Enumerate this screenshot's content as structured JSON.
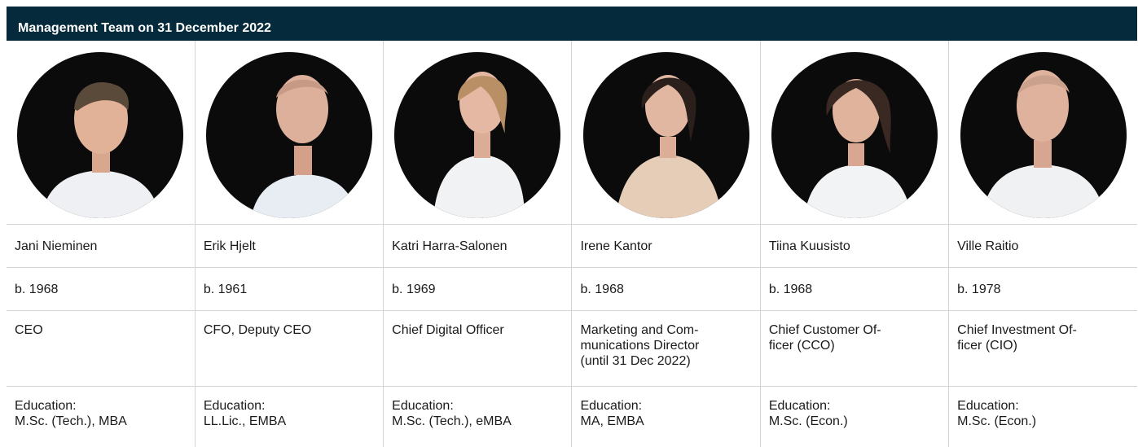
{
  "header": {
    "title": "Management Team on 31 December 2022"
  },
  "members": [
    {
      "name": "Jani Nieminen",
      "birth": "b. 1968",
      "title": "CEO",
      "education_label": "Education:",
      "education": "M.Sc. (Tech.), MBA"
    },
    {
      "name": "Erik Hjelt",
      "birth": "b. 1961",
      "title": "CFO, Deputy CEO",
      "education_label": "Education:",
      "education": "LL.Lic., EMBA"
    },
    {
      "name": "Katri Harra-Salonen",
      "birth": "b. 1969",
      "title": "Chief Digital Officer",
      "education_label": "Education:",
      "education": "M.Sc. (Tech.), eMBA"
    },
    {
      "name": "Irene Kantor",
      "birth": "b. 1968",
      "title": "Marketing and Com-\nmunications Director\n(until 31 Dec 2022)",
      "education_label": "Education:",
      "education": "MA, EMBA"
    },
    {
      "name": "Tiina Kuusisto",
      "birth": "b. 1968",
      "title": "Chief Customer Of-\nficer (CCO)",
      "education_label": "Education:",
      "education": "M.Sc. (Econ.)"
    },
    {
      "name": "Ville Raitio",
      "birth": "b. 1978",
      "title": "Chief Investment Of-\nficer (CIO)",
      "education_label": "Education:",
      "education": "M.Sc. (Econ.)"
    }
  ],
  "colors": {
    "header_bg": "#052a3b",
    "header_text": "#ffffff",
    "grid": "#d4d4d4",
    "photo_bg": "#0b0b0b"
  }
}
